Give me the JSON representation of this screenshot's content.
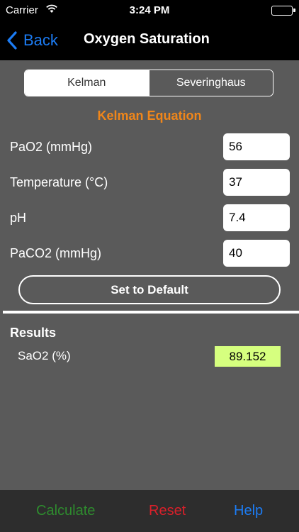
{
  "status_bar": {
    "carrier": "Carrier",
    "time": "3:24 PM"
  },
  "nav": {
    "back_label": "Back",
    "title": "Oxygen Saturation"
  },
  "segments": [
    {
      "label": "Kelman",
      "selected": true
    },
    {
      "label": "Severinghaus",
      "selected": false
    }
  ],
  "equation_title": "Kelman Equation",
  "inputs": [
    {
      "label": "PaO2 (mmHg)",
      "value": "56"
    },
    {
      "label": "Temperature (°C)",
      "value": "37"
    },
    {
      "label": "pH",
      "value": "7.4"
    },
    {
      "label": "PaCO2 (mmHg)",
      "value": "40"
    }
  ],
  "default_button": "Set to Default",
  "results": {
    "title": "Results",
    "label": "SaO2 (%)",
    "value": "89.152"
  },
  "toolbar": {
    "calculate": "Calculate",
    "reset": "Reset",
    "help": "Help"
  },
  "colors": {
    "accent_orange": "#f0861a",
    "ios_blue": "#1c7cf4",
    "calculate_green": "#2e8b2e",
    "reset_red": "#d9202a",
    "result_highlight": "#d6ff7f"
  }
}
